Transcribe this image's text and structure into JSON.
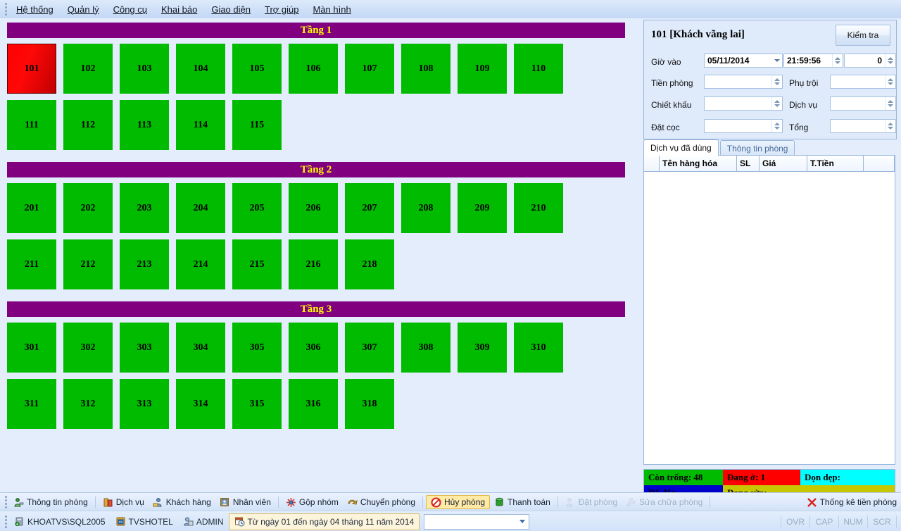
{
  "menu": {
    "items": [
      {
        "label": "Hệ thống"
      },
      {
        "label": "Quản lý"
      },
      {
        "label": "Công cụ"
      },
      {
        "label": "Khai báo"
      },
      {
        "label": "Giao diện"
      },
      {
        "label": "Trợ giúp"
      },
      {
        "label": "Màn hình"
      }
    ]
  },
  "floors": [
    {
      "title": "Tầng 1",
      "rows": [
        [
          "101",
          "102",
          "103",
          "104",
          "105",
          "106",
          "107",
          "108",
          "109",
          "110"
        ],
        [
          "111",
          "112",
          "113",
          "114",
          "115"
        ]
      ]
    },
    {
      "title": "Tầng 2",
      "rows": [
        [
          "201",
          "202",
          "203",
          "204",
          "205",
          "206",
          "207",
          "208",
          "209",
          "210"
        ],
        [
          "211",
          "212",
          "213",
          "214",
          "215",
          "216",
          "218"
        ]
      ]
    },
    {
      "title": "Tầng 3",
      "rows": [
        [
          "301",
          "302",
          "303",
          "304",
          "305",
          "306",
          "307",
          "308",
          "309",
          "310"
        ],
        [
          "311",
          "312",
          "313",
          "314",
          "315",
          "316",
          "318"
        ]
      ]
    }
  ],
  "occupied_rooms": [
    "101"
  ],
  "colors": {
    "room_free": "#00bb00",
    "room_occupied": "#ff0000",
    "floor_header_bg": "#800080",
    "floor_header_text": "#ffff00",
    "legend_clean": "#00ffff",
    "legend_booked": "#0000cc",
    "legend_repair": "#c8c800",
    "panel_bg": "#e4edfb"
  },
  "panel": {
    "room_title": "101 [Khách vãng lai]",
    "check_button": "Kiểm tra",
    "fields": {
      "time_in_label": "Giờ vào",
      "date_value": "05/11/2014",
      "time_value": "21:59:56",
      "guests_value": "0",
      "room_price_label": "Tiền phòng",
      "room_price_value": "",
      "surcharge_label": "Phụ trội",
      "surcharge_value": "",
      "discount_label": "Chiết khấu",
      "discount_value": "",
      "service_label": "Dịch vụ",
      "service_value": "",
      "deposit_label": "Đặt cọc",
      "deposit_value": "",
      "total_label": "Tổng",
      "total_value": ""
    },
    "tabs": [
      {
        "label": "Dịch vụ đã dùng",
        "active": true
      },
      {
        "label": "Thông tin phòng",
        "active": false
      }
    ],
    "grid": {
      "columns": [
        "",
        "Tên hàng hóa",
        "SL",
        "Giá",
        "T.Tiền",
        ""
      ],
      "rows": []
    },
    "legend": [
      {
        "label": "Còn trống: 48",
        "bg": "#00bb00",
        "fg": "#000000"
      },
      {
        "label": "Đang ở: 1",
        "bg": "#ff0000",
        "fg": "#000000"
      },
      {
        "label": "Dọn dẹp:",
        "bg": "#00ffff",
        "fg": "#000000"
      },
      {
        "label": "Đã đặt:",
        "bg": "#0000cc",
        "fg": "#000000"
      },
      {
        "label": "Đang sửa:",
        "bg": "#c8c800",
        "fg": "#000000"
      }
    ]
  },
  "toolbar": {
    "items": [
      {
        "label": "Thông tin phòng",
        "icon": "room-info-icon",
        "state": "normal"
      },
      {
        "label": "Dịch vụ",
        "icon": "service-icon",
        "state": "normal"
      },
      {
        "label": "Khách hàng",
        "icon": "customer-icon",
        "state": "normal"
      },
      {
        "label": "Nhân viên",
        "icon": "staff-icon",
        "state": "normal"
      },
      {
        "label": "Gộp nhóm",
        "icon": "merge-icon",
        "state": "normal"
      },
      {
        "label": "Chuyển phòng",
        "icon": "transfer-icon",
        "state": "normal"
      },
      {
        "label": "Hủy phòng",
        "icon": "cancel-icon",
        "state": "highlight"
      },
      {
        "label": "Thanh toán",
        "icon": "payment-icon",
        "state": "normal"
      },
      {
        "label": "Đặt phòng",
        "icon": "booking-icon",
        "state": "disabled"
      },
      {
        "label": "Sửa chữa phòng",
        "icon": "repair-icon",
        "state": "disabled"
      },
      {
        "label": "Thống kê tiền phòng",
        "icon": "statistics-icon",
        "state": "normal"
      }
    ]
  },
  "statusbar": {
    "server": "KHOATVS\\SQL2005",
    "database": "TVSHOTEL",
    "user": "ADMIN",
    "date_range": "Từ ngày 01 đến ngày 04 tháng 11 năm 2014",
    "combo_value": "",
    "flags": [
      "OVR",
      "CAP",
      "NUM",
      "SCR"
    ]
  }
}
